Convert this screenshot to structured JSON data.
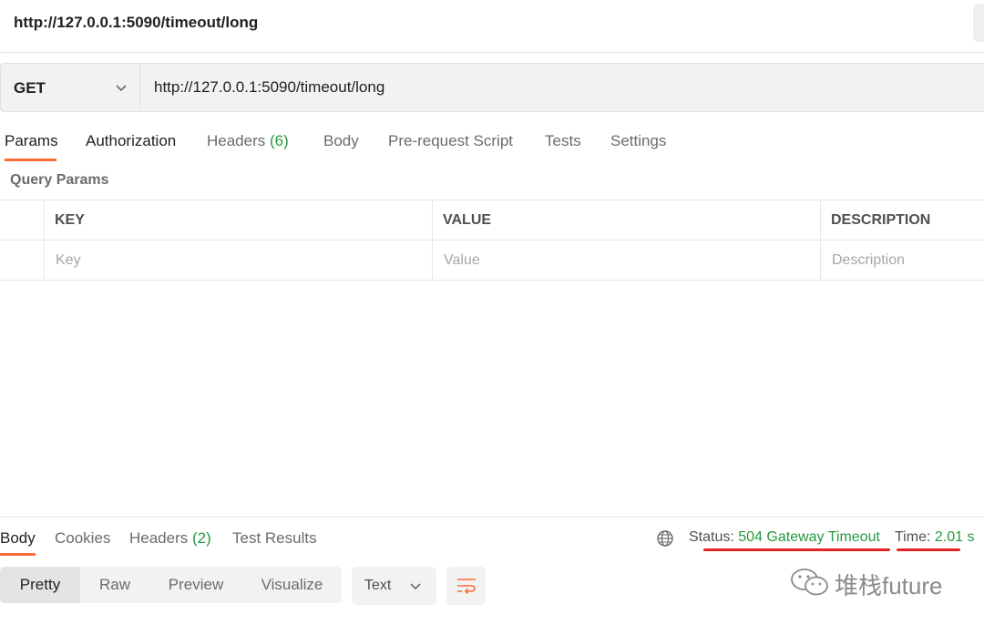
{
  "header": {
    "title": "http://127.0.0.1:5090/timeout/long"
  },
  "request": {
    "method": "GET",
    "url": "http://127.0.0.1:5090/timeout/long"
  },
  "request_tabs": [
    {
      "label": "Params",
      "count": ""
    },
    {
      "label": "Authorization",
      "count": ""
    },
    {
      "label": "Headers",
      "count": "(6)"
    },
    {
      "label": "Body",
      "count": ""
    },
    {
      "label": "Pre-request Script",
      "count": ""
    },
    {
      "label": "Tests",
      "count": ""
    },
    {
      "label": "Settings",
      "count": ""
    }
  ],
  "query_params": {
    "title": "Query Params",
    "columns": [
      "KEY",
      "VALUE",
      "DESCRIPTION"
    ],
    "placeholders": [
      "Key",
      "Value",
      "Description"
    ]
  },
  "response_tabs": [
    {
      "label": "Body",
      "count": ""
    },
    {
      "label": "Cookies",
      "count": ""
    },
    {
      "label": "Headers",
      "count": "(2)"
    },
    {
      "label": "Test Results",
      "count": ""
    }
  ],
  "response_status": {
    "status_label": "Status:",
    "status_value": "504 Gateway Timeout",
    "time_label": "Time:",
    "time_value": "2.01 s"
  },
  "response_view": {
    "modes": [
      "Pretty",
      "Raw",
      "Preview",
      "Visualize"
    ],
    "format": "Text"
  },
  "watermark": {
    "text": "堆栈future"
  },
  "colors": {
    "accent_orange": "#ff6c37",
    "status_green": "#26993e",
    "annotation_red": "#e02424"
  }
}
